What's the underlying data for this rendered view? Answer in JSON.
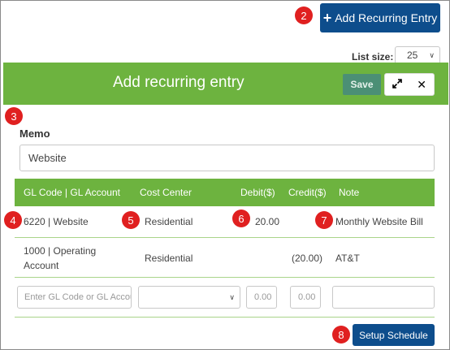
{
  "toolbar": {
    "add_label": "Add Recurring Entry",
    "add_icon": "plus-icon"
  },
  "list_size": {
    "label": "List size:",
    "value": "25"
  },
  "modal": {
    "title": "Add recurring entry",
    "save_label": "Save",
    "expand_icon": "expand-icon",
    "close_icon": "close-icon",
    "memo_label": "Memo",
    "memo_value": "Website"
  },
  "table": {
    "headers": [
      "GL Code | GL Account",
      "Cost Center",
      "Debit($)",
      "Credit($)",
      "Note"
    ],
    "rows": [
      {
        "gl": "6220 | Website",
        "gl2": "",
        "cost_center": "Residential",
        "debit": "20.00",
        "credit": "",
        "note": "Monthly Website Bill"
      },
      {
        "gl": "1000 | Operating",
        "gl2": "Account",
        "cost_center": "Residential",
        "debit": "",
        "credit": "(20.00)",
        "note": "AT&T"
      }
    ],
    "new_row": {
      "gl_placeholder": "Enter GL Code or GL Account",
      "debit_placeholder": "0.00",
      "credit_placeholder": "0.00"
    }
  },
  "setup_label": "Setup Schedule",
  "badges": [
    "2",
    "3",
    "4",
    "5",
    "6",
    "7",
    "8"
  ],
  "colors": {
    "accent_green": "#6db33f",
    "primary_blue": "#0d4d8c",
    "badge_red": "#e02020",
    "save_green": "#4b8f75"
  }
}
